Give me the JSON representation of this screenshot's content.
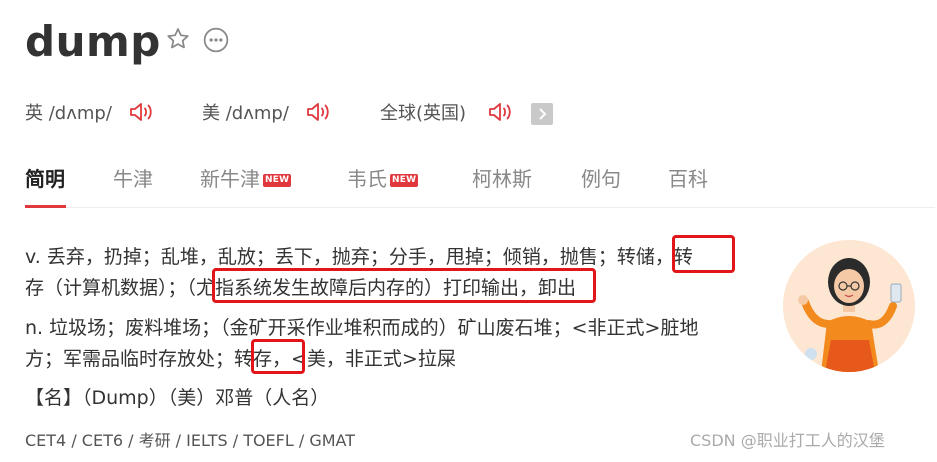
{
  "headword": "dump",
  "icons": {
    "favorite": "star-outline-icon",
    "more": "more-options-icon",
    "speaker": "speaker-icon",
    "play": "play-icon"
  },
  "pronunciations": [
    {
      "label": "英 /dʌmp/"
    },
    {
      "label": "美 /dʌmp/"
    },
    {
      "label": "全球(英国)"
    }
  ],
  "tabs": [
    {
      "label": "简明",
      "active": true
    },
    {
      "label": "牛津"
    },
    {
      "label": "新牛津",
      "badge": "NEW"
    },
    {
      "label": "韦氏",
      "badge": "NEW"
    },
    {
      "label": "柯林斯"
    },
    {
      "label": "例句"
    },
    {
      "label": "百科"
    }
  ],
  "definitions": {
    "line1": "v. 丢弃，扔掉；乱堆，乱放；丢下，抛弃；分手，甩掉；倾销，抛售；转储，转",
    "line2": "存（计算机数据）；（尤指系统发生故障后内存的）打印输出，卸出",
    "line3": "n. 垃圾场；废料堆场；（金矿开采作业堆积而成的）矿山废石堆；<非正式>脏地",
    "line4": "方；军需品临时存放处；转存，<美，非正式>拉屎",
    "line5": "【名】（Dump）（美）邓普（人名）"
  },
  "exams": "CET4 / CET6 / 考研 / IELTS / TOEFL / GMAT",
  "watermark": "CSDN @职业打工人的汉堡",
  "colors": {
    "accent": "#e0383d",
    "highlight_box": "#e0161b"
  }
}
